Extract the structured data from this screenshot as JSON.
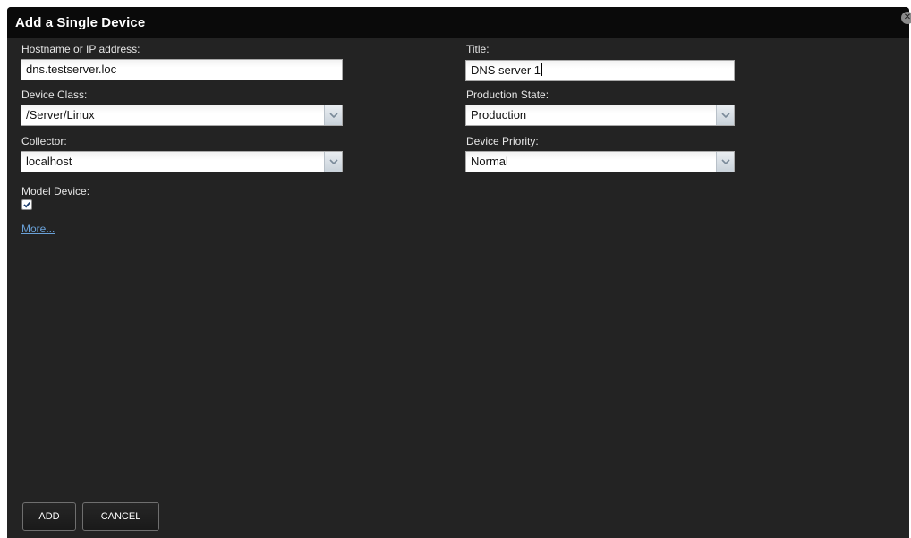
{
  "dialog": {
    "title": "Add a Single Device",
    "close_icon": "close-icon"
  },
  "form": {
    "hostname": {
      "label": "Hostname or IP address:",
      "value": "dns.testserver.loc"
    },
    "title": {
      "label": "Title:",
      "value": "DNS server 1"
    },
    "device_class": {
      "label": "Device Class:",
      "value": "/Server/Linux"
    },
    "production_state": {
      "label": "Production State:",
      "value": "Production"
    },
    "collector": {
      "label": "Collector:",
      "value": "localhost"
    },
    "device_priority": {
      "label": "Device Priority:",
      "value": "Normal"
    },
    "model_device": {
      "label": "Model Device:",
      "checked": true
    },
    "more_link": "More..."
  },
  "buttons": {
    "add": "ADD",
    "cancel": "CANCEL"
  },
  "colors": {
    "dialog_bg": "#232323",
    "titlebar_bg": "#0a0a0a",
    "link": "#6aa1d8"
  }
}
